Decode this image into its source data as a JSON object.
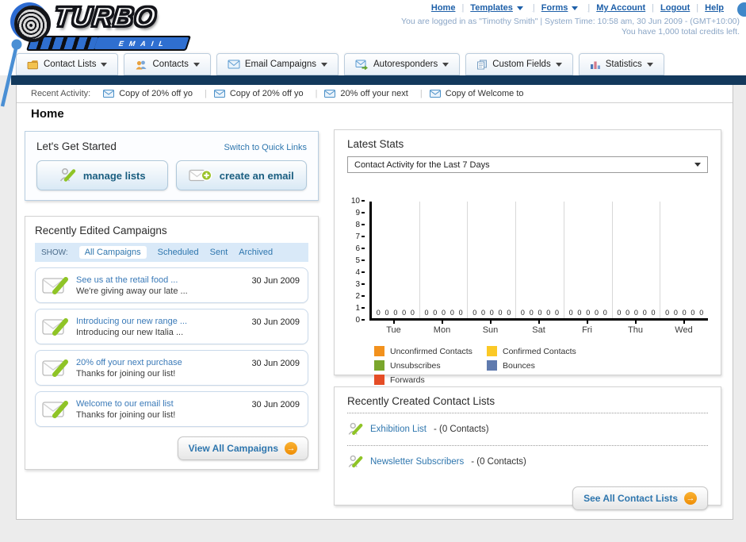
{
  "page": {
    "title": "Home"
  },
  "header": {
    "logo": {
      "word": "TURBO",
      "sub": "EMAIL"
    },
    "nav": [
      {
        "label": "Home",
        "dropdown": false
      },
      {
        "label": "Templates",
        "dropdown": true
      },
      {
        "label": "Forms",
        "dropdown": true
      },
      {
        "label": "My Account",
        "dropdown": false
      },
      {
        "label": "Logout",
        "dropdown": false
      },
      {
        "label": "Help",
        "dropdown": false
      }
    ],
    "login_line": "You are logged in as \"Timothy Smith\" | System Time: 10:58 am, 30 Jun 2009 - (GMT+10:00)",
    "credits_line": "You have 1,000 total credits left."
  },
  "tabs": [
    {
      "label": "Contact Lists",
      "icon": "folder-icon"
    },
    {
      "label": "Contacts",
      "icon": "contacts-icon"
    },
    {
      "label": "Email Campaigns",
      "icon": "email-icon"
    },
    {
      "label": "Autoresponders",
      "icon": "autoresponder-icon"
    },
    {
      "label": "Custom Fields",
      "icon": "custom-fields-icon"
    },
    {
      "label": "Statistics",
      "icon": "statistics-icon"
    }
  ],
  "recent_activity": {
    "label": "Recent Activity:",
    "items": [
      "Copy of 20% off yo",
      "Copy of 20% off yo",
      "20% off your next",
      "Copy of Welcome to"
    ]
  },
  "get_started": {
    "title": "Let's Get Started",
    "switch_link": "Switch to Quick Links",
    "manage_lists_label": "manage lists",
    "create_email_label": "create an email"
  },
  "campaigns": {
    "title": "Recently Edited Campaigns",
    "show_label": "SHOW:",
    "filters": [
      "All Campaigns",
      "Scheduled",
      "Sent",
      "Archived"
    ],
    "items": [
      {
        "title": "See us at the retail food ...",
        "subtitle": "We're giving away our late ...",
        "date": "30 Jun 2009"
      },
      {
        "title": "Introducing our new range ...",
        "subtitle": "Introducing our new Italia ...",
        "date": "30 Jun 2009"
      },
      {
        "title": "20% off your next purchase",
        "subtitle": "Thanks for joining our list!",
        "date": "30 Jun 2009"
      },
      {
        "title": "Welcome to our email list",
        "subtitle": "Thanks for joining our list!",
        "date": "30 Jun 2009"
      }
    ],
    "view_all_label": "View All Campaigns"
  },
  "stats": {
    "title": "Latest Stats",
    "dropdown_value": "Contact Activity for the Last 7 Days",
    "chart_data": {
      "type": "bar",
      "title": "Contact Activity for the Last 7 Days",
      "categories": [
        "Tue",
        "Mon",
        "Sun",
        "Sat",
        "Fri",
        "Thu",
        "Wed"
      ],
      "series": [
        {
          "name": "Unconfirmed Contacts",
          "color": "#F2911D",
          "values": [
            0,
            0,
            0,
            0,
            0,
            0,
            0
          ]
        },
        {
          "name": "Confirmed Contacts",
          "color": "#FBC926",
          "values": [
            0,
            0,
            0,
            0,
            0,
            0,
            0
          ]
        },
        {
          "name": "Unsubscribes",
          "color": "#7AA62C",
          "values": [
            0,
            0,
            0,
            0,
            0,
            0,
            0
          ]
        },
        {
          "name": "Bounces",
          "color": "#5F7AAE",
          "values": [
            0,
            0,
            0,
            0,
            0,
            0,
            0
          ]
        },
        {
          "name": "Forwards",
          "color": "#E54D26",
          "values": [
            0,
            0,
            0,
            0,
            0,
            0,
            0
          ]
        }
      ],
      "ylim": [
        0,
        10
      ],
      "grid": "vertical-only",
      "legend_position": "bottom",
      "value_labels_shown": true
    }
  },
  "contact_lists": {
    "title": "Recently Created Contact Lists",
    "items": [
      {
        "name": "Exhibition List",
        "detail": " - (0 Contacts)"
      },
      {
        "name": "Newsletter Subscribers",
        "detail": " - (0 Contacts)"
      }
    ],
    "see_all_label": "See All Contact Lists"
  }
}
